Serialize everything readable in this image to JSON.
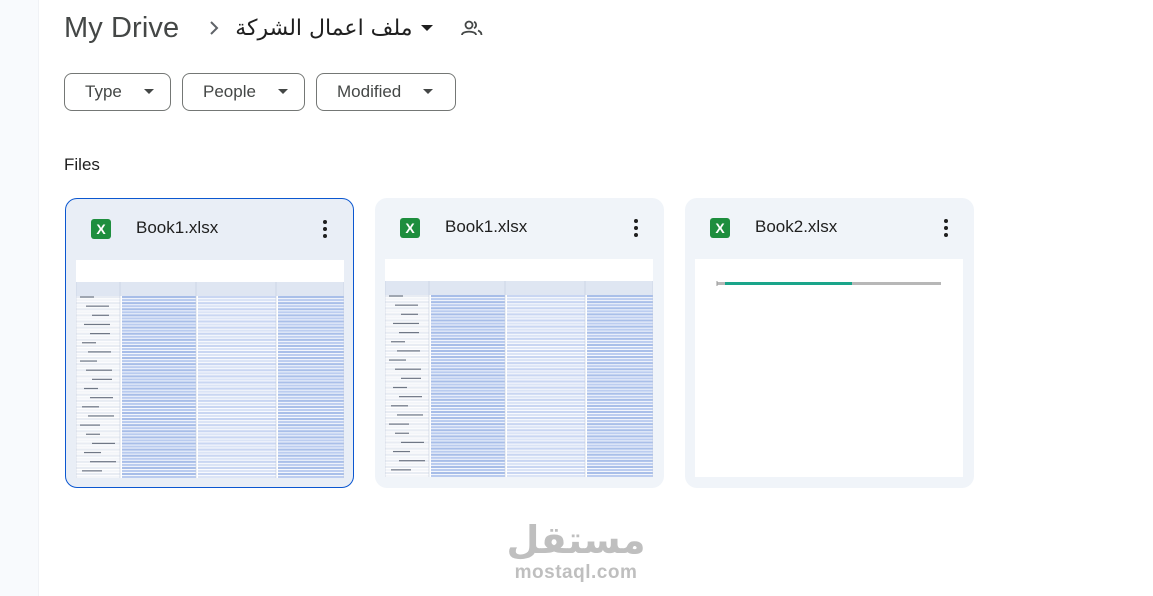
{
  "breadcrumb": {
    "root": "My Drive",
    "current": "ملف اعمال الشركة"
  },
  "filters": [
    {
      "label": "Type"
    },
    {
      "label": "People"
    },
    {
      "label": "Modified"
    }
  ],
  "section": {
    "files_label": "Files"
  },
  "files": [
    {
      "name": "Book1.xlsx",
      "icon": "excel-icon",
      "letter": "X",
      "selected": true
    },
    {
      "name": "Book1.xlsx",
      "icon": "excel-icon",
      "letter": "X",
      "selected": false
    },
    {
      "name": "Book2.xlsx",
      "icon": "excel-icon",
      "letter": "X",
      "selected": false
    }
  ],
  "watermark": {
    "arabic": "مستقل",
    "latin": "mostaql.com"
  },
  "colors": {
    "accent": "#0b57d0",
    "excel": "#1e8e3e",
    "card_bg": "#f0f4f9",
    "selected_bg": "#e9eef6"
  }
}
